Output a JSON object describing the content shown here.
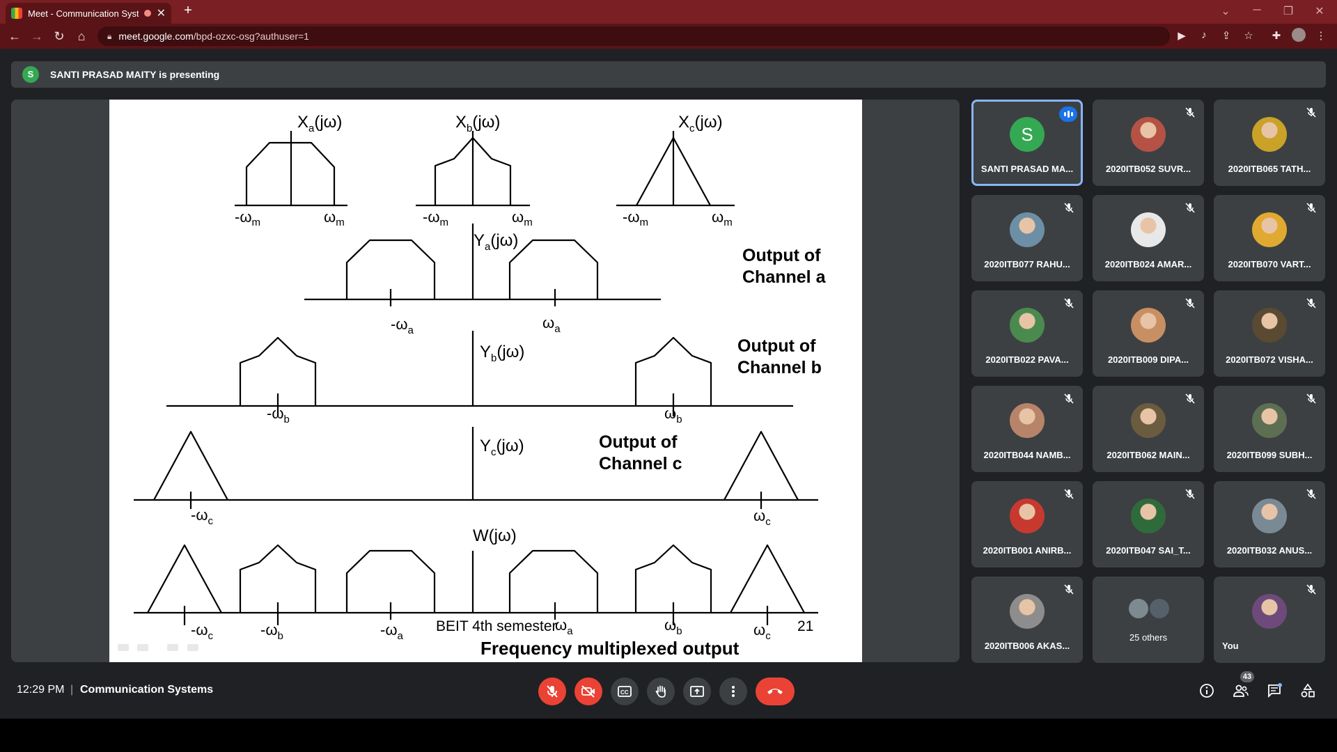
{
  "browser": {
    "tab_title": "Meet - Communication Syste",
    "url_host": "meet.google.com",
    "url_path": "/bpd-ozxc-osg?authuser=1"
  },
  "presenting": {
    "avatar_letter": "S",
    "text": "SANTI PRASAD MAITY is presenting"
  },
  "slide": {
    "xa": "X",
    "xa_sub": "a",
    "jw": "(jω)",
    "xb": "X",
    "xb_sub": "b",
    "xc": "X",
    "xc_sub": "c",
    "neg_wm": "-ω",
    "wm": "ω",
    "m": "m",
    "ya": "Y",
    "ya_sub": "a",
    "yb": "Y",
    "yb_sub": "b",
    "yc": "Y",
    "yc_sub": "c",
    "neg_w": "-ω",
    "w": "ω",
    "sub_a": "a",
    "sub_b": "b",
    "sub_c": "c",
    "out_a_1": "Output of",
    "out_a_2": "Channel a",
    "out_b_1": "Output of",
    "out_b_2": "Channel b",
    "out_c_1": "Output of",
    "out_c_2": "Channel c",
    "wjw": "W(jω)",
    "footer_semester": "BEIT 4th semester",
    "page_number": "21",
    "caption": "Frequency multiplexed output"
  },
  "participants": [
    {
      "name": "SANTI PRASAD MA...",
      "letter": "S",
      "speaking": true,
      "color": "#34a853"
    },
    {
      "name": "2020ITB052 SUVR...",
      "color": "#b55245",
      "muted": true
    },
    {
      "name": "2020ITB065 TATH...",
      "color": "#c9a227",
      "muted": true
    },
    {
      "name": "2020ITB077 RAHU...",
      "color": "#6d8fa6",
      "muted": true
    },
    {
      "name": "2020ITB024 AMAR...",
      "color": "#e8e8e8",
      "muted": true
    },
    {
      "name": "2020ITB070 VART...",
      "color": "#e0a930",
      "muted": true
    },
    {
      "name": "2020ITB022 PAVA...",
      "color": "#4b8a4e",
      "muted": true
    },
    {
      "name": "2020ITB009 DIPA...",
      "color": "#c88f63",
      "muted": true
    },
    {
      "name": "2020ITB072 VISHA...",
      "color": "#5a4a32",
      "muted": true
    },
    {
      "name": "2020ITB044 NAMB...",
      "color": "#b7846a",
      "muted": true
    },
    {
      "name": "2020ITB062 MAIN...",
      "color": "#6b5b3f",
      "muted": true
    },
    {
      "name": "2020ITB099 SUBH...",
      "color": "#5d6f52",
      "muted": true
    },
    {
      "name": "2020ITB001 ANIRB...",
      "color": "#c7392f",
      "muted": true
    },
    {
      "name": "2020ITB047 SAI_T...",
      "color": "#2f6b3a",
      "muted": true
    },
    {
      "name": "2020ITB032 ANUS...",
      "color": "#7a8a95",
      "muted": true
    },
    {
      "name": "2020ITB006 AKAS...",
      "color": "#8d8d8d",
      "muted": true
    },
    {
      "name": "25 others",
      "others": true
    },
    {
      "name": "You",
      "color": "#6d4a7a",
      "muted": true,
      "you": true
    }
  ],
  "bottom": {
    "time": "12:29 PM",
    "separator": "|",
    "meeting_name": "Communication Systems",
    "people_count": "43"
  },
  "colors": {
    "tab_bar": "#7a1f23",
    "address_bar": "#5a1418",
    "meet_bg": "#202124",
    "tile_bg": "#3c4043",
    "danger": "#ea4335",
    "active_outline": "#8ab4f8"
  }
}
